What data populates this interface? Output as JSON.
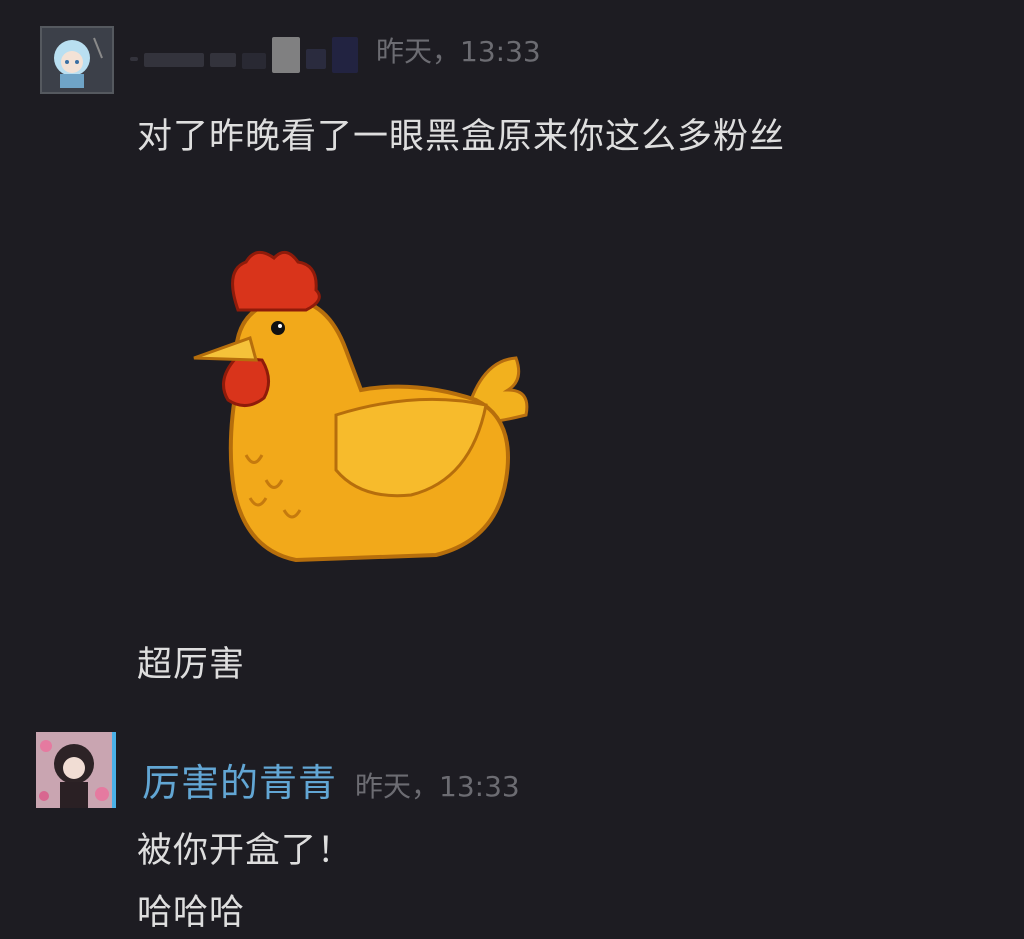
{
  "messages": [
    {
      "username": "",
      "timestamp": "昨天，13:33",
      "lines": [
        "对了昨晚看了一眼黑盒原来你这么多粉丝"
      ],
      "sticker": "chicken-sticker",
      "after_sticker": [
        "超厉害"
      ]
    },
    {
      "username": "厉害的青青",
      "timestamp": "昨天，13:33",
      "lines": [
        "被你开盒了！",
        "哈哈哈"
      ]
    }
  ],
  "colors": {
    "background": "#1d1c22",
    "username": "#62a6d4",
    "timestamp": "#6c6c72",
    "text": "#dedede"
  }
}
